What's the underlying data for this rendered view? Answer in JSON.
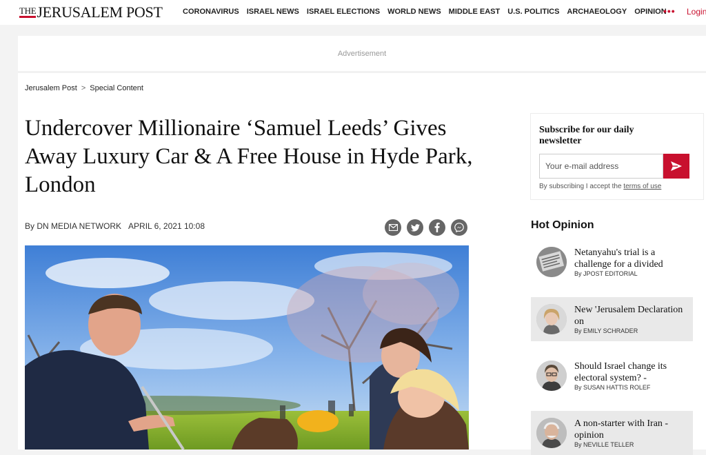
{
  "header": {
    "logo_the": "THE",
    "logo_name": "JERUSALEM POST",
    "nav": [
      "CORONAVIRUS",
      "ISRAEL NEWS",
      "ISRAEL ELECTIONS",
      "WORLD NEWS",
      "MIDDLE EAST",
      "U.S. POLITICS",
      "ARCHAEOLOGY",
      "OPINION"
    ],
    "menu_dots": "•••",
    "login": "Login"
  },
  "ad": {
    "label": "Advertisement"
  },
  "breadcrumb": {
    "home": "Jerusalem Post",
    "separator": ">",
    "section": "Special Content"
  },
  "article": {
    "headline": "Undercover Millionaire ‘Samuel Leeds’ Gives Away Luxury Car & A Free House in Hyde Park, London",
    "byline": "By DN MEDIA NETWORK",
    "date": "APRIL 6, 2021 10:08"
  },
  "share": {
    "icons": [
      "email-icon",
      "twitter-icon",
      "facebook-icon",
      "messenger-icon"
    ]
  },
  "newsletter": {
    "title": "Subscribe for our daily newsletter",
    "placeholder": "Your e-mail address",
    "note": "By subscribing I accept the",
    "terms": "terms of use"
  },
  "hot_opinion": {
    "title": "Hot Opinion",
    "items": [
      {
        "title": "Netanyahu's trial is a challenge for a divided",
        "author": "By JPOST EDITORIAL"
      },
      {
        "title": "New 'Jerusalem Declaration on",
        "author": "By EMILY SCHRADER"
      },
      {
        "title": "Should Israel change its electoral system? -",
        "author": "By SUSAN HATTIS ROLEF"
      },
      {
        "title": "A non-starter with Iran - opinion",
        "author": "By NEVILLE TELLER"
      }
    ]
  },
  "colors": {
    "brand_red": "#c8102e"
  }
}
